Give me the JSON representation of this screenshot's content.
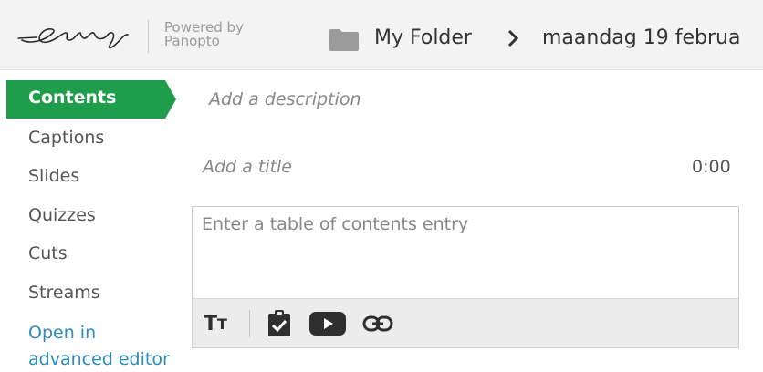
{
  "header": {
    "logo_alt": "Erasmus",
    "powered_line1": "Powered by",
    "powered_line2": "Panopto",
    "folder_label": "My Folder",
    "session_title": "maandag 19 februa"
  },
  "nav": {
    "active": "Contents",
    "items": [
      "Captions",
      "Slides",
      "Quizzes",
      "Cuts",
      "Streams"
    ],
    "link_line1": "Open in",
    "link_line2": "advanced editor"
  },
  "main": {
    "description_placeholder": "Add a description",
    "title_placeholder": "Add a title",
    "time": "0:00",
    "entry_placeholder": "Enter a table of contents entry"
  },
  "toolbar": {
    "text_style_big": "T",
    "text_style_small": "T"
  },
  "colors": {
    "accent": "#1e9e4a",
    "link": "#2e8bbd",
    "header_bg": "#f3f3f3"
  }
}
